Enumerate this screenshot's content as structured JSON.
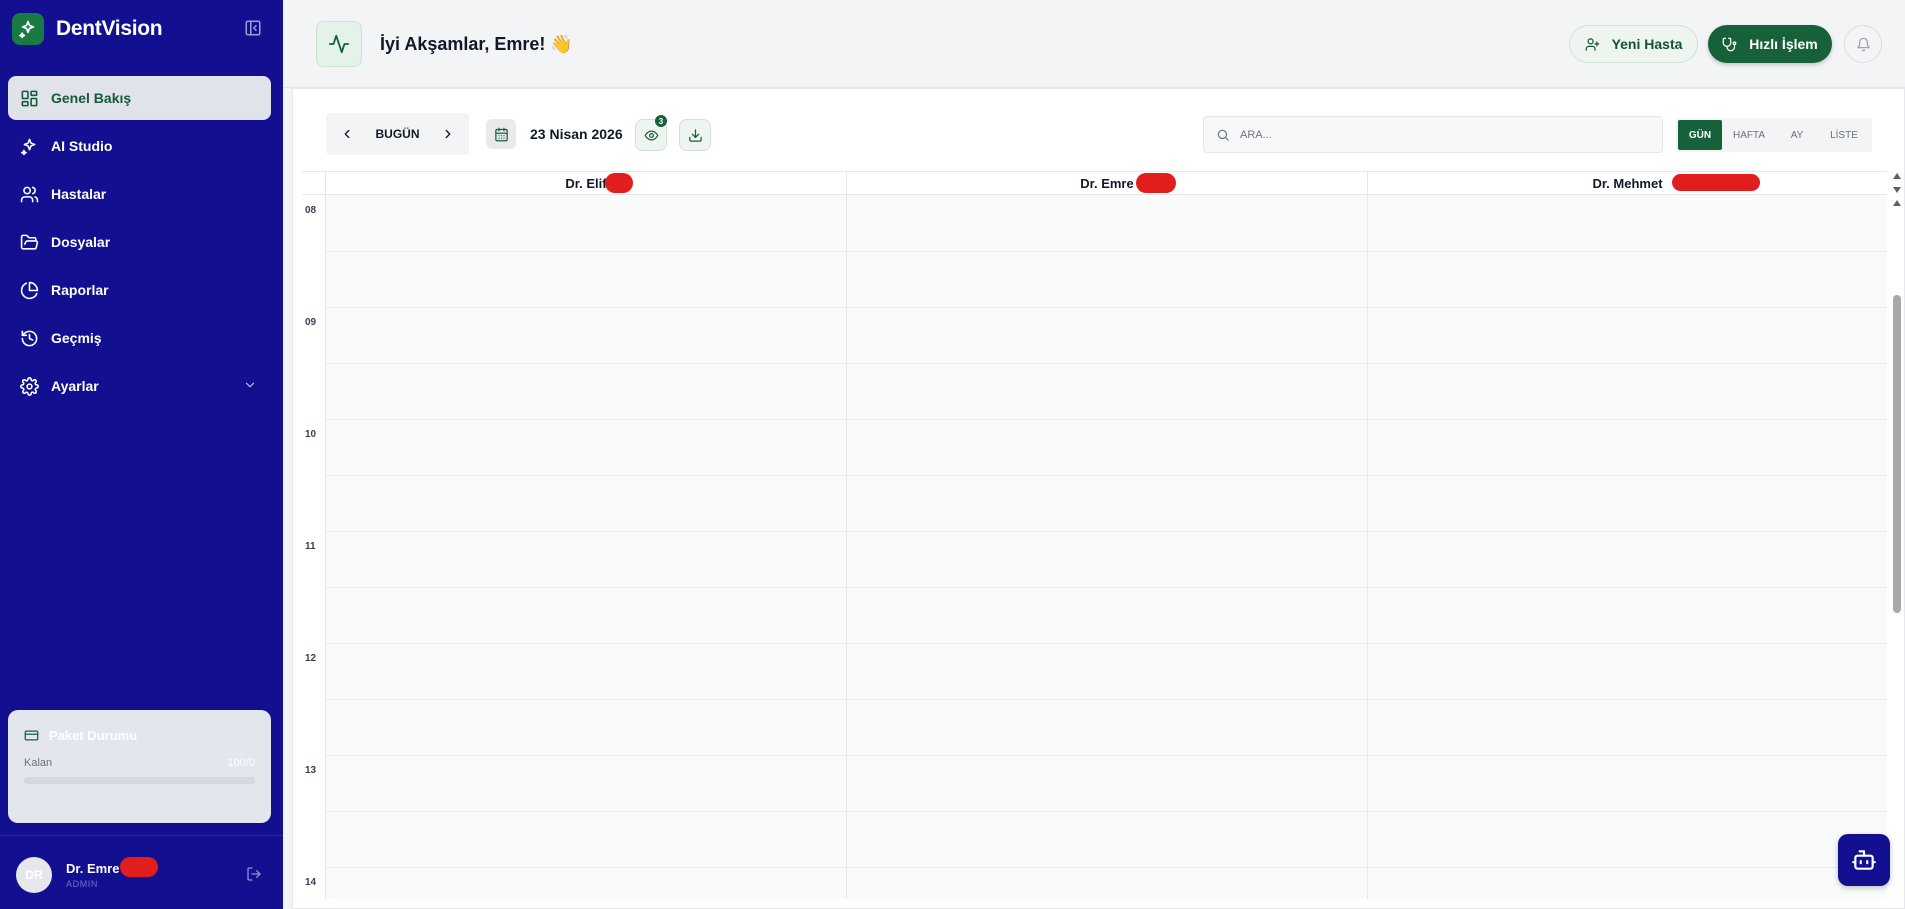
{
  "app": {
    "name": "DentVision"
  },
  "sidebar": {
    "items": [
      {
        "label": "Genel Bakış",
        "icon": "dashboard-icon",
        "active": true
      },
      {
        "label": "AI Studio",
        "icon": "sparkles-icon"
      },
      {
        "label": "Hastalar",
        "icon": "users-icon"
      },
      {
        "label": "Dosyalar",
        "icon": "folder-icon"
      },
      {
        "label": "Raporlar",
        "icon": "pie-chart-icon"
      },
      {
        "label": "Geçmiş",
        "icon": "history-icon"
      },
      {
        "label": "Ayarlar",
        "icon": "settings-icon",
        "expandable": true
      }
    ],
    "package": {
      "title": "Paket Durumu",
      "remaining_label": "Kalan",
      "remaining_value": "100/0",
      "progress": 0
    },
    "user": {
      "initials": "DR",
      "name": "Dr. Emre",
      "role": "ADMIN"
    }
  },
  "header": {
    "greeting": "İyi Akşamlar, Emre! 👋",
    "new_patient_label": "Yeni Hasta",
    "quick_action_label": "Hızlı İşlem"
  },
  "toolbar": {
    "today_label": "BUGÜN",
    "date": "23 Nisan 2026",
    "visible_count": "3",
    "search_placeholder": "ARA...",
    "views": [
      "GÜN",
      "HAFTA",
      "AY",
      "LİSTE"
    ],
    "active_view": "GÜN"
  },
  "calendar": {
    "doctors": [
      "Dr. Elif",
      "Dr. Emre",
      "Dr. Mehmet"
    ],
    "hours": [
      "08",
      "09",
      "10",
      "11",
      "12",
      "13",
      "14"
    ]
  },
  "colors": {
    "sidebar_bg": "#121090",
    "accent_green": "#16613a",
    "active_nav_bg": "#e0e3ea",
    "redaction": "#e11d1d"
  }
}
